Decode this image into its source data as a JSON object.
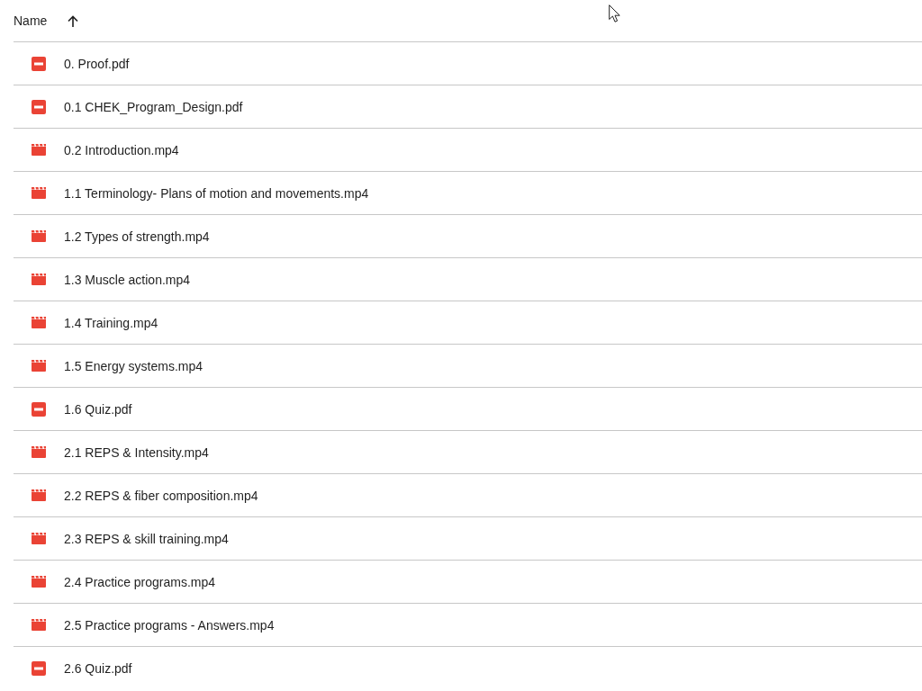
{
  "header": {
    "column": "Name",
    "sort_ascending": true
  },
  "files": [
    {
      "name": "0. Proof.pdf",
      "kind": "pdf"
    },
    {
      "name": "0.1 CHEK_Program_Design.pdf",
      "kind": "pdf"
    },
    {
      "name": "0.2 Introduction.mp4",
      "kind": "video"
    },
    {
      "name": "1.1 Terminology- Plans of motion and movements.mp4",
      "kind": "video"
    },
    {
      "name": "1.2 Types of strength.mp4",
      "kind": "video"
    },
    {
      "name": "1.3 Muscle action.mp4",
      "kind": "video"
    },
    {
      "name": "1.4 Training.mp4",
      "kind": "video"
    },
    {
      "name": "1.5 Energy systems.mp4",
      "kind": "video"
    },
    {
      "name": "1.6 Quiz.pdf",
      "kind": "pdf"
    },
    {
      "name": "2.1 REPS & Intensity.mp4",
      "kind": "video"
    },
    {
      "name": "2.2 REPS & fiber composition.mp4",
      "kind": "video"
    },
    {
      "name": "2.3 REPS & skill training.mp4",
      "kind": "video"
    },
    {
      "name": "2.4 Practice programs.mp4",
      "kind": "video"
    },
    {
      "name": "2.5 Practice programs - Answers.mp4",
      "kind": "video"
    },
    {
      "name": "2.6 Quiz.pdf",
      "kind": "pdf"
    }
  ]
}
